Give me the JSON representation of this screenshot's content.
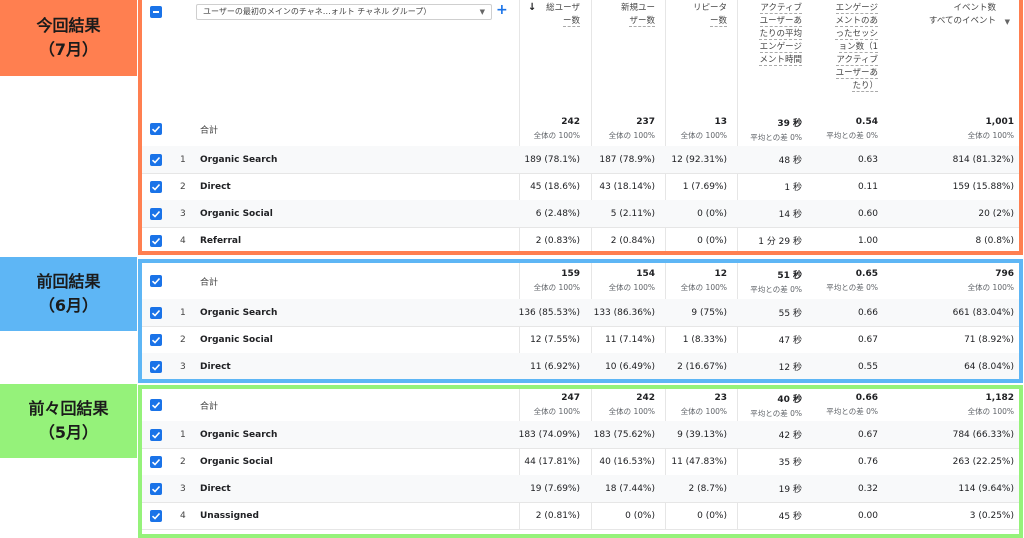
{
  "labels": {
    "july": [
      "今回結果",
      "（7月）"
    ],
    "june": [
      "前回結果",
      "（6月）"
    ],
    "may": [
      "前々回結果",
      "（5月）"
    ]
  },
  "colors": {
    "july": "#ff7f50",
    "june": "#5eb6f5",
    "may": "#95f27a",
    "checkbox": "#1a73e8"
  },
  "header": {
    "dimension_select": "ユーザーの最初のメインのチャネ…ォルト チャネル グループ）",
    "add_icon": "+",
    "sort_icon": "↓",
    "columns": [
      [
        "総ユーザ",
        "ー数"
      ],
      [
        "新規ユー",
        "ザー数"
      ],
      [
        "リピータ",
        "ー数"
      ],
      [
        "アクティブ",
        "ユーザーあ",
        "たりの平均",
        "エンゲージ",
        "メント時間"
      ],
      [
        "エンゲージ",
        "メントのあ",
        "ったセッシ",
        "ョン数（1",
        "アクティブ",
        "ユーザーあ",
        "たり）"
      ],
      [
        "イベント数",
        "すべてのイベント"
      ]
    ]
  },
  "tables": {
    "july": {
      "total": {
        "label": "合計",
        "values": [
          "242",
          "237",
          "13",
          "39 秒",
          "0.54",
          "1,001"
        ],
        "subs": [
          "全体の 100%",
          "全体の 100%",
          "全体の 100%",
          "平均との差 0%",
          "平均との差 0%",
          "全体の 100%"
        ]
      },
      "rows": [
        {
          "n": "1",
          "name": "Organic Search",
          "v": [
            "189 (78.1%)",
            "187 (78.9%)",
            "12 (92.31%)",
            "48 秒",
            "0.63",
            "814 (81.32%)"
          ]
        },
        {
          "n": "2",
          "name": "Direct",
          "v": [
            "45 (18.6%)",
            "43 (18.14%)",
            "1 (7.69%)",
            "1 秒",
            "0.11",
            "159 (15.88%)"
          ]
        },
        {
          "n": "3",
          "name": "Organic Social",
          "v": [
            "6 (2.48%)",
            "5 (2.11%)",
            "0 (0%)",
            "14 秒",
            "0.60",
            "20 (2%)"
          ]
        },
        {
          "n": "4",
          "name": "Referral",
          "v": [
            "2 (0.83%)",
            "2 (0.84%)",
            "0 (0%)",
            "1 分 29 秒",
            "1.00",
            "8 (0.8%)"
          ]
        }
      ]
    },
    "june": {
      "total": {
        "label": "合計",
        "values": [
          "159",
          "154",
          "12",
          "51 秒",
          "0.65",
          "796"
        ],
        "subs": [
          "全体の 100%",
          "全体の 100%",
          "全体の 100%",
          "平均との差 0%",
          "平均との差 0%",
          "全体の 100%"
        ]
      },
      "rows": [
        {
          "n": "1",
          "name": "Organic Search",
          "v": [
            "136 (85.53%)",
            "133 (86.36%)",
            "9 (75%)",
            "55 秒",
            "0.66",
            "661 (83.04%)"
          ]
        },
        {
          "n": "2",
          "name": "Organic Social",
          "v": [
            "12 (7.55%)",
            "11 (7.14%)",
            "1 (8.33%)",
            "47 秒",
            "0.67",
            "71 (8.92%)"
          ]
        },
        {
          "n": "3",
          "name": "Direct",
          "v": [
            "11 (6.92%)",
            "10 (6.49%)",
            "2 (16.67%)",
            "12 秒",
            "0.55",
            "64 (8.04%)"
          ]
        }
      ]
    },
    "may": {
      "total": {
        "label": "合計",
        "values": [
          "247",
          "242",
          "23",
          "40 秒",
          "0.66",
          "1,182"
        ],
        "subs": [
          "全体の 100%",
          "全体の 100%",
          "全体の 100%",
          "平均との差 0%",
          "平均との差 0%",
          "全体の 100%"
        ]
      },
      "rows": [
        {
          "n": "1",
          "name": "Organic Search",
          "v": [
            "183 (74.09%)",
            "183 (75.62%)",
            "9 (39.13%)",
            "42 秒",
            "0.67",
            "784 (66.33%)"
          ]
        },
        {
          "n": "2",
          "name": "Organic Social",
          "v": [
            "44 (17.81%)",
            "40 (16.53%)",
            "11 (47.83%)",
            "35 秒",
            "0.76",
            "263 (22.25%)"
          ]
        },
        {
          "n": "3",
          "name": "Direct",
          "v": [
            "19 (7.69%)",
            "18 (7.44%)",
            "2 (8.7%)",
            "19 秒",
            "0.32",
            "114 (9.64%)"
          ]
        },
        {
          "n": "4",
          "name": "Unassigned",
          "v": [
            "2 (0.81%)",
            "0 (0%)",
            "0 (0%)",
            "45 秒",
            "0.00",
            "3 (0.25%)"
          ]
        }
      ]
    }
  }
}
